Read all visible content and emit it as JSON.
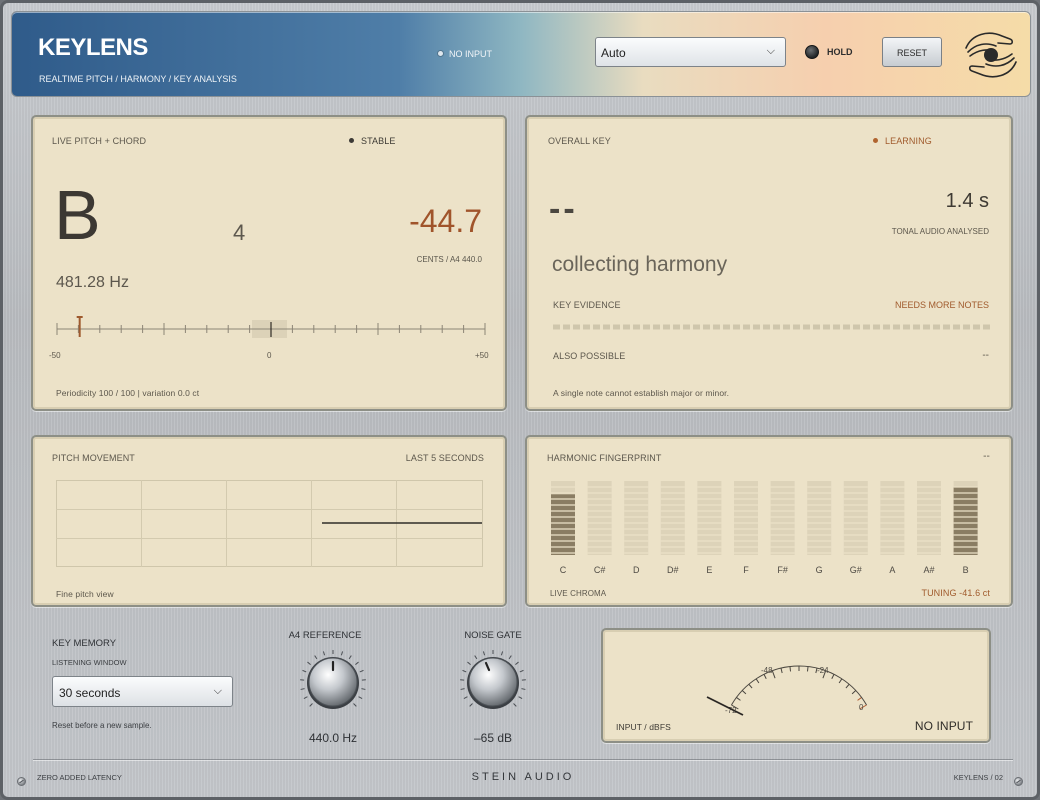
{
  "header": {
    "title": "KEYLENS",
    "subtitle": "REALTIME PITCH  /  HARMONY  /  KEY ANALYSIS",
    "input_status": "NO INPUT",
    "mode_select": {
      "value": "Auto"
    },
    "hold_label": "HOLD",
    "reset_label": "RESET",
    "logo_icon": "hands-circle-icon"
  },
  "pitch_panel": {
    "title": "LIVE PITCH + CHORD",
    "status": "STABLE",
    "note": "B",
    "octave": "4",
    "cents": "-44.7",
    "cents_ref": "CENTS / A4 440.0",
    "frequency": "481.28 Hz",
    "scale": {
      "min_label": "-50",
      "mid_label": "0",
      "max_label": "+50",
      "needle_cents": -44.7
    },
    "footer": "Periodicity 100 / 100   |   variation 0.0 ct"
  },
  "key_panel": {
    "title": "OVERALL KEY",
    "status": "LEARNING",
    "key": "--",
    "analysed_time": "1.4 s",
    "analysed_label": "TONAL AUDIO ANALYSED",
    "key_status": "collecting harmony",
    "evidence_label": "KEY EVIDENCE",
    "evidence_note": "NEEDS MORE NOTES",
    "also_label": "ALSO POSSIBLE",
    "also_value": "--",
    "footer": "A single note cannot establish major or minor."
  },
  "movement_panel": {
    "title": "PITCH MOVEMENT",
    "range_label": "LAST 5 SECONDS",
    "footer": "Fine pitch view"
  },
  "chroma_panel": {
    "title": "HARMONIC FINGERPRINT",
    "value": "--",
    "notes": [
      "C",
      "C#",
      "D",
      "D#",
      "E",
      "F",
      "F#",
      "G",
      "G#",
      "A",
      "A#",
      "B"
    ],
    "levels": [
      0.82,
      0,
      0,
      0,
      0,
      0,
      0,
      0,
      0,
      0,
      0,
      0.92
    ],
    "footer": "LIVE CHROMA",
    "tuning": "TUNING -41.6 ct"
  },
  "controls": {
    "key_memory_title": "KEY MEMORY",
    "window_label": "LISTENING WINDOW",
    "window_value": "30 seconds",
    "reset_hint": "Reset before a new sample.",
    "a4_title": "A4 REFERENCE",
    "a4_value": "440.0 Hz",
    "gate_title": "NOISE GATE",
    "gate_value": "–65 dB"
  },
  "meter": {
    "scale_labels": [
      "-72",
      "-48",
      "-24",
      "0"
    ],
    "label": "INPUT / dBFS",
    "status": "NO INPUT"
  },
  "footer": {
    "left": "ZERO ADDED LATENCY",
    "brand": "STEIN AUDIO",
    "right": "KEYLENS / 02"
  },
  "colors": {
    "accent": "#a0542b",
    "panel": "#ece2c8",
    "header_blue": "#2f5b8a",
    "header_peach": "#f6cfae"
  }
}
